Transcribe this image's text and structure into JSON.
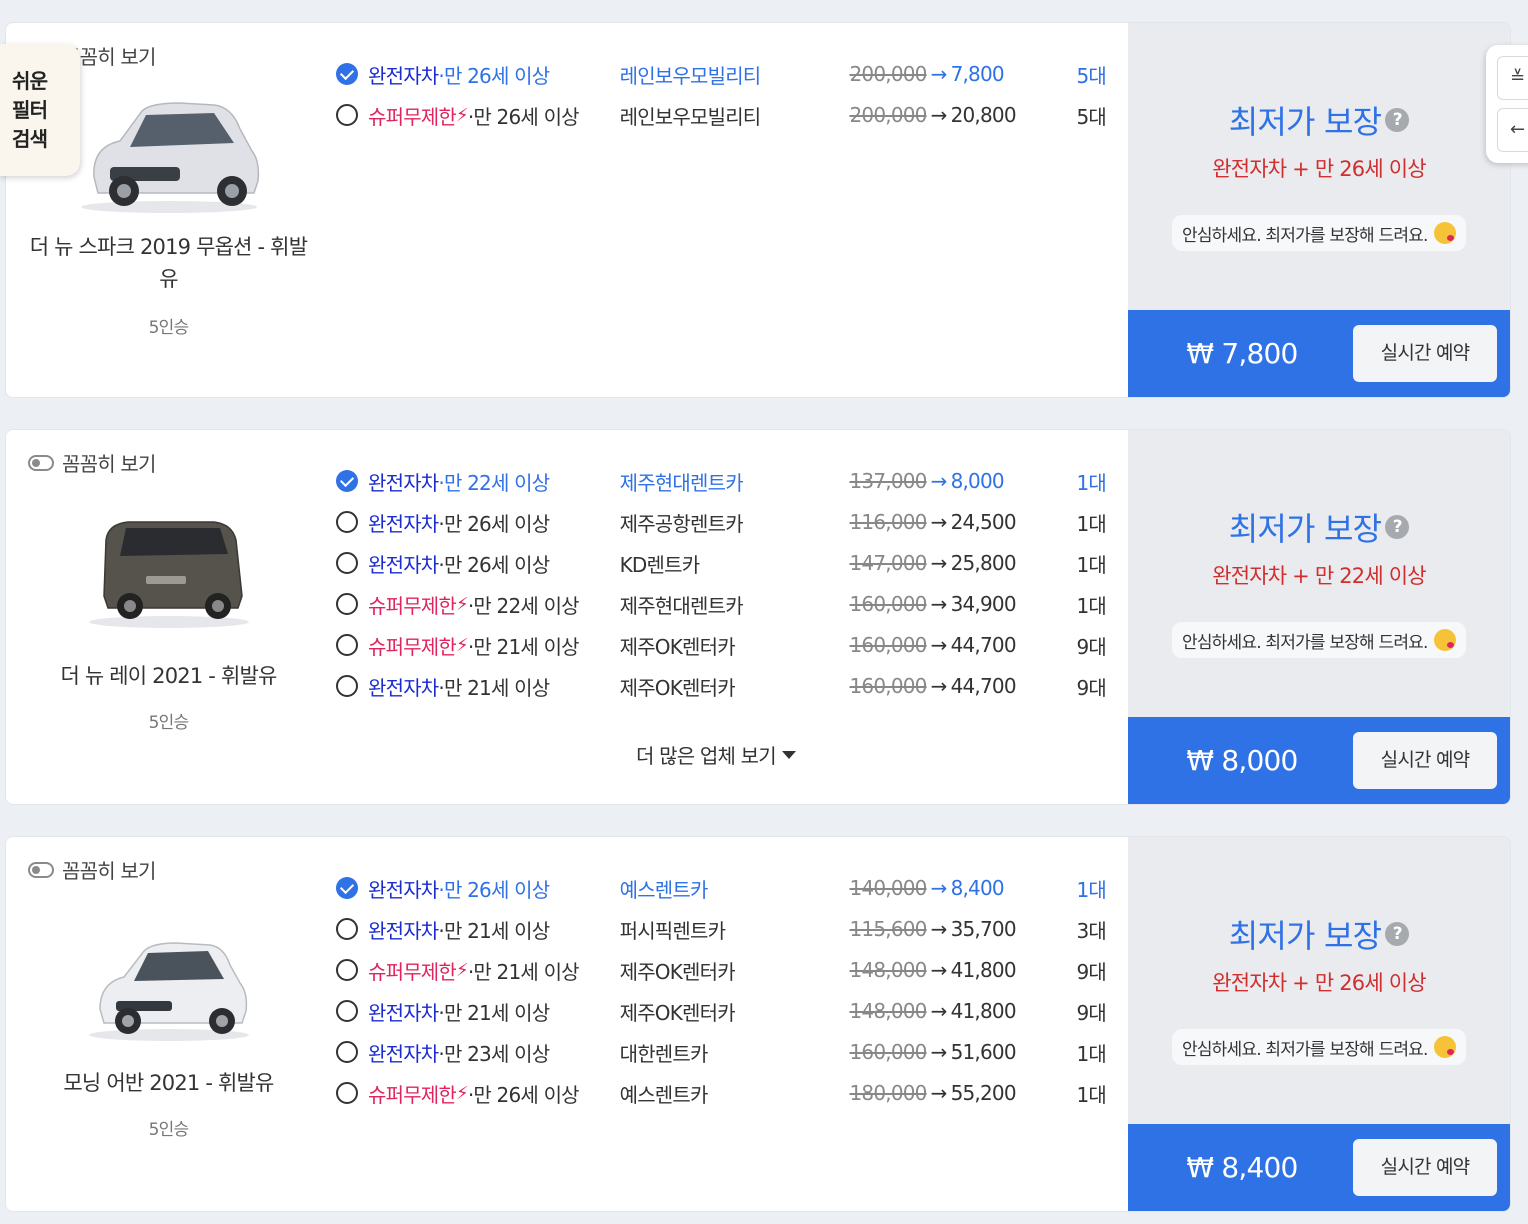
{
  "easy_filter": {
    "line1": "쉬운",
    "line2": "필터",
    "line3": "검색"
  },
  "side_tools": {
    "filter_icon": "≚",
    "back_icon": "←"
  },
  "cards": [
    {
      "toggle_label": "꼼꼼히 보기",
      "car_name": "더 뉴 스파크 2019 무옵션 - 휘발유",
      "seats": "5인승",
      "car_color": "#dfe1e6",
      "offers": [
        {
          "ins_type": "완전자차",
          "age": "·만 26세 이상",
          "company": "레인보우모빌리티",
          "old_price": "200,000",
          "new_price": "7,800",
          "count": "5대"
        },
        {
          "ins_type": "슈퍼무제한",
          "age": "·만 26세 이상",
          "company": "레인보우모빌리티",
          "old_price": "200,000",
          "new_price": "20,800",
          "count": "5대"
        }
      ],
      "best_title": "최저가 보장",
      "best_sub": "완전자차 + 만 26세 이상",
      "assure": "안심하세요. 최저가를 보장해 드려요.",
      "total": "₩ 7,800",
      "reserve": "실시간 예약"
    },
    {
      "toggle_label": "꼼꼼히 보기",
      "car_name": "더 뉴 레이 2021 - 휘발유",
      "seats": "5인승",
      "car_color": "#55534c",
      "offers": [
        {
          "ins_type": "완전자차",
          "age": "·만 22세 이상",
          "company": "제주현대렌트카",
          "old_price": "137,000",
          "new_price": "8,000",
          "count": "1대"
        },
        {
          "ins_type": "완전자차",
          "age": "·만 26세 이상",
          "company": "제주공항렌트카",
          "old_price": "116,000",
          "new_price": "24,500",
          "count": "1대"
        },
        {
          "ins_type": "완전자차",
          "age": "·만 26세 이상",
          "company": "KD렌트카",
          "old_price": "147,000",
          "new_price": "25,800",
          "count": "1대"
        },
        {
          "ins_type": "슈퍼무제한",
          "age": "·만 22세 이상",
          "company": "제주현대렌트카",
          "old_price": "160,000",
          "new_price": "34,900",
          "count": "1대"
        },
        {
          "ins_type": "슈퍼무제한",
          "age": "·만 21세 이상",
          "company": "제주OK렌터카",
          "old_price": "160,000",
          "new_price": "44,700",
          "count": "9대"
        },
        {
          "ins_type": "완전자차",
          "age": "·만 21세 이상",
          "company": "제주OK렌터카",
          "old_price": "160,000",
          "new_price": "44,700",
          "count": "9대"
        }
      ],
      "more": "더 많은 업체 보기",
      "best_title": "최저가 보장",
      "best_sub": "완전자차 + 만 22세 이상",
      "assure": "안심하세요. 최저가를 보장해 드려요.",
      "total": "₩ 8,000",
      "reserve": "실시간 예약"
    },
    {
      "toggle_label": "꼼꼼히 보기",
      "car_name": "모닝 어반 2021 - 휘발유",
      "seats": "5인승",
      "car_color": "#eceef1",
      "offers": [
        {
          "ins_type": "완전자차",
          "age": "·만 26세 이상",
          "company": "예스렌트카",
          "old_price": "140,000",
          "new_price": "8,400",
          "count": "1대"
        },
        {
          "ins_type": "완전자차",
          "age": "·만 21세 이상",
          "company": "퍼시픽렌트카",
          "old_price": "115,600",
          "new_price": "35,700",
          "count": "3대"
        },
        {
          "ins_type": "슈퍼무제한",
          "age": "·만 21세 이상",
          "company": "제주OK렌터카",
          "old_price": "148,000",
          "new_price": "41,800",
          "count": "9대"
        },
        {
          "ins_type": "완전자차",
          "age": "·만 21세 이상",
          "company": "제주OK렌터카",
          "old_price": "148,000",
          "new_price": "41,800",
          "count": "9대"
        },
        {
          "ins_type": "완전자차",
          "age": "·만 23세 이상",
          "company": "대한렌트카",
          "old_price": "160,000",
          "new_price": "51,600",
          "count": "1대"
        },
        {
          "ins_type": "슈퍼무제한",
          "age": "·만 26세 이상",
          "company": "예스렌트카",
          "old_price": "180,000",
          "new_price": "55,200",
          "count": "1대"
        }
      ],
      "best_title": "최저가 보장",
      "best_sub": "완전자차 + 만 26세 이상",
      "assure": "안심하세요. 최저가를 보장해 드려요.",
      "total": "₩ 8,400",
      "reserve": "실시간 예약"
    }
  ]
}
